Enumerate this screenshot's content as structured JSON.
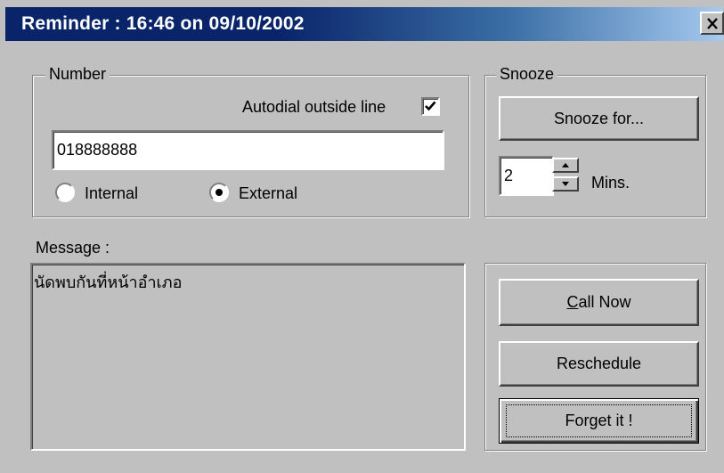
{
  "window": {
    "title": "Reminder : 16:46 on 09/10/2002"
  },
  "number_group": {
    "label": "Number",
    "autodial_label": "Autodial outside line",
    "autodial_checked": true,
    "phone_value": "018888888",
    "radio_internal_label": "Internal",
    "radio_external_label": "External",
    "selected": "External"
  },
  "snooze_group": {
    "label": "Snooze",
    "snooze_button": "Snooze for...",
    "minutes_value": "2",
    "minutes_unit": "Mins."
  },
  "message": {
    "label": "Message :",
    "text": "นัดพบกันที่หน้าอำเภอ"
  },
  "actions": {
    "call_now_prefix": "C",
    "call_now_rest": "all Now",
    "reschedule": "Reschedule",
    "forget": "Forget it !"
  },
  "colors": {
    "title_bar_start": "#0a246a",
    "title_bar_end": "#a6caf0",
    "face": "#c0c0c0"
  }
}
